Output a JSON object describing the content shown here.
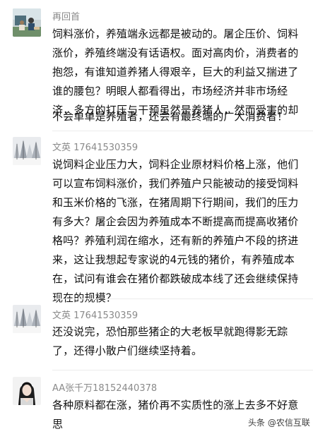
{
  "comments": [
    {
      "username": "再回首",
      "avatar_icon": "sitting-people-photo-avatar",
      "lines": [
        "饲料涨价，养殖端永远都是被动的。屠企压价、饲料",
        "涨价，养殖终端没有话语权。面对高肉价，消费者的",
        "抱怨，有谁知道养猪人得艰辛，巨大的利益又揣进了",
        "谁的腰包？明眼人都看得出，市场经济并非市场经",
        "济，多方的打压与干预虽然是养猪人，然而受害的却",
        "不会单单是养殖者，还会有最终端的广大消费者！"
      ]
    },
    {
      "username": "文英 17641530359",
      "avatar_icon": "snowy-trees-photo-avatar",
      "lines": [
        "说饲料企业压力大，饲料企业原材料价格上涨，他们",
        "可以宣布饲料涨价，我们养殖户只能被动的接受饲料",
        "和玉米价格的飞涨，在猪周期下行期间，我们的压力",
        "有多大？屠企会因为养殖成本不断提高而提高收猪价",
        "格吗？养殖利润在缩水，还有新的养殖户不段的挤进",
        "来，这让我想起专家说的4元钱的猪价，有养殖成本",
        "在，试问有谁会在猪价都跌破成本线了还会继续保持",
        "现在的规模？"
      ]
    },
    {
      "username": "文英 17641530359",
      "avatar_icon": "snowy-trees-photo-avatar",
      "lines": [
        "还没说完，恐怕那些猪企的大老板早就跑得影无踪",
        "了，还得小散户们继续坚持着。"
      ]
    },
    {
      "username": "AA张千万18152440378",
      "avatar_icon": "person-portrait-avatar",
      "lines": [
        "各种原料都在涨，猪价再不实质性的涨上去多不好意",
        "思"
      ]
    }
  ],
  "watermark": "头条 @农信互联"
}
